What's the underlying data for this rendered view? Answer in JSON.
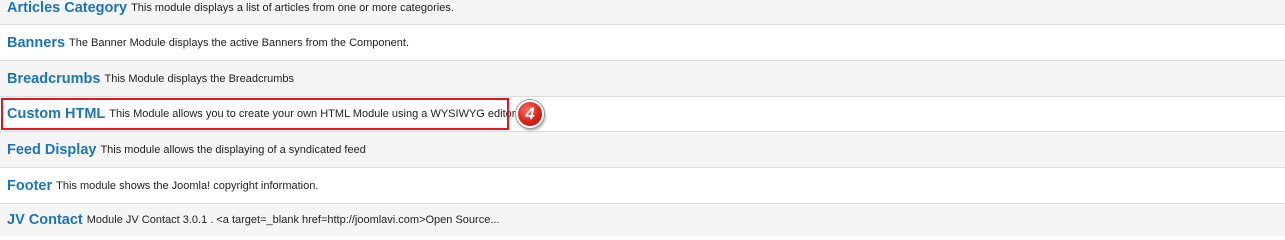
{
  "modules": [
    {
      "title": "Articles Category",
      "description": "This module displays a list of articles from one or more categories."
    },
    {
      "title": "Banners",
      "description": "The Banner Module displays the active Banners from the Component."
    },
    {
      "title": "Breadcrumbs",
      "description": "This Module displays the Breadcrumbs"
    },
    {
      "title": "Custom HTML",
      "description": "This Module allows you to create your own HTML Module using a WYSIWYG editor."
    },
    {
      "title": "Feed Display",
      "description": "This module allows the displaying of a syndicated feed"
    },
    {
      "title": "Footer",
      "description": "This module shows the Joomla! copyright information."
    },
    {
      "title": "JV Contact",
      "description": "Module JV Contact 3.0.1 . <a target=_blank href=http://joomlavi.com>Open Source..."
    }
  ],
  "annotation": {
    "step_number": "4",
    "highlight_color": "#e8141b"
  },
  "colors": {
    "link": "#1b75b6",
    "row_alt": "#f5f5f5"
  }
}
